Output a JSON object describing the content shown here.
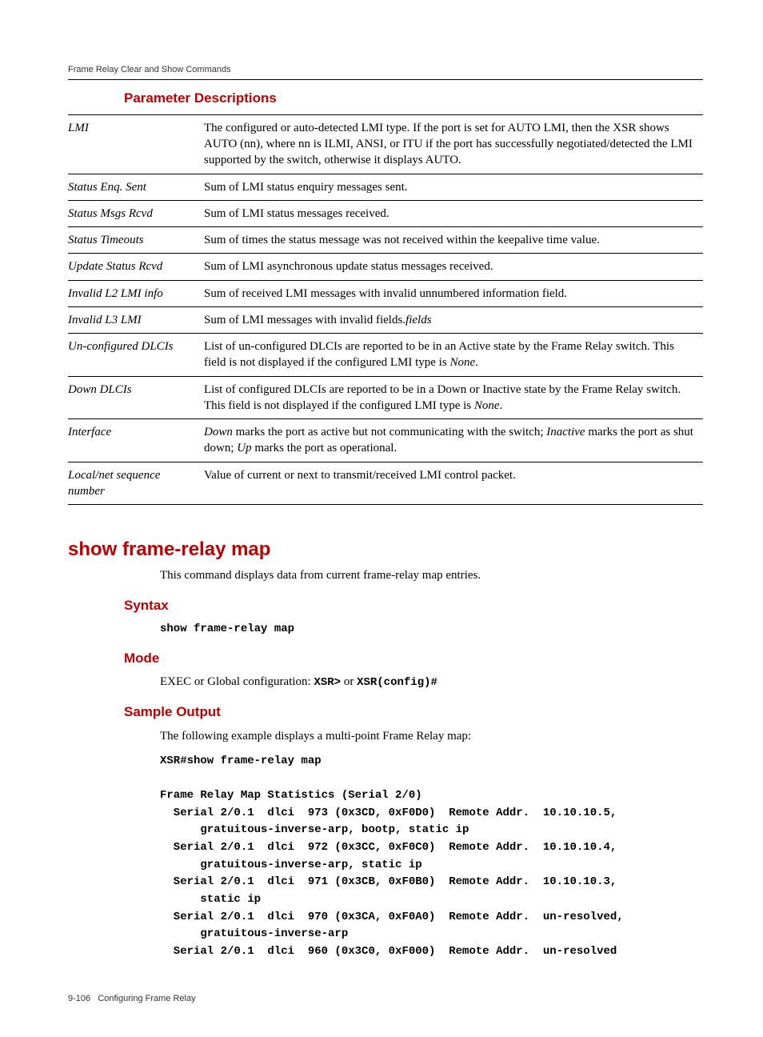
{
  "header": {
    "breadcrumb": "Frame Relay Clear and Show Commands"
  },
  "section1": {
    "title": "Parameter Descriptions",
    "rows": [
      {
        "name": "LMI",
        "desc": "The configured or auto-detected LMI type. If the port is set for AUTO LMI, then the XSR shows AUTO (nn), where nn is ILMI, ANSI, or ITU if the port has successfully negotiated/detected the LMI supported by the switch, otherwise it displays AUTO."
      },
      {
        "name": "Status Enq. Sent",
        "desc": "Sum of LMI status enquiry messages sent."
      },
      {
        "name": "Status Msgs Rcvd",
        "desc": "Sum of LMI status messages received."
      },
      {
        "name": "Status Timeouts",
        "desc": "Sum of times the status message was not received within the keepalive time value."
      },
      {
        "name": "Update Status Rcvd",
        "desc": "Sum of LMI asynchronous update status messages received."
      },
      {
        "name": "Invalid L2 LMI info",
        "desc": "Sum of received LMI messages with invalid unnumbered information field."
      },
      {
        "name": "Invalid L3 LMI",
        "desc_prefix": "Sum of LMI messages with invalid fields.",
        "desc_italic": "fields"
      },
      {
        "name": "Un-configured DLCIs",
        "desc_prefix": "List of un-configured DLCIs are reported to be in an Active state by the Frame Relay switch. This field is not displayed if the configured LMI type is ",
        "desc_italic": "None",
        "desc_suffix": "."
      },
      {
        "name": "Down DLCIs",
        "desc_prefix": "List of configured DLCIs are reported to be in a Down or Inactive state by the Frame Relay switch. This field is not displayed if the configured LMI type is ",
        "desc_italic": "None",
        "desc_suffix": "."
      },
      {
        "name": "Interface",
        "desc_i1": "Down",
        "desc_t1": " marks the port as active but not communicating with the switch; ",
        "desc_i2": "Inactive",
        "desc_t2": " marks the port as shut down; ",
        "desc_i3": "Up",
        "desc_t3": " marks the port as operational."
      },
      {
        "name": "Local/net sequence number",
        "desc": "Value of current or next to transmit/received LMI control packet."
      }
    ]
  },
  "command": {
    "title": "show frame-relay map",
    "intro": "This command displays data from current frame-relay map entries.",
    "syntax_heading": "Syntax",
    "syntax_code": "show frame-relay map",
    "mode_heading": "Mode",
    "mode_text": "EXEC or Global configuration: ",
    "mode_code1": "XSR>",
    "mode_or": "  or  ",
    "mode_code2": "XSR(config)#",
    "sample_heading": "Sample Output",
    "sample_text": "The following example displays a multi-point Frame Relay map:",
    "sample_output": "XSR#show frame-relay map\n\nFrame Relay Map Statistics (Serial 2/0)\n  Serial 2/0.1  dlci  973 (0x3CD, 0xF0D0)  Remote Addr.  10.10.10.5,\n      gratuitous-inverse-arp, bootp, static ip\n  Serial 2/0.1  dlci  972 (0x3CC, 0xF0C0)  Remote Addr.  10.10.10.4,\n      gratuitous-inverse-arp, static ip\n  Serial 2/0.1  dlci  971 (0x3CB, 0xF0B0)  Remote Addr.  10.10.10.3,\n      static ip\n  Serial 2/0.1  dlci  970 (0x3CA, 0xF0A0)  Remote Addr.  un-resolved,\n      gratuitous-inverse-arp\n  Serial 2/0.1  dlci  960 (0x3C0, 0xF000)  Remote Addr.  un-resolved"
  },
  "footer": {
    "page": "9-106",
    "chapter": "Configuring Frame Relay"
  }
}
